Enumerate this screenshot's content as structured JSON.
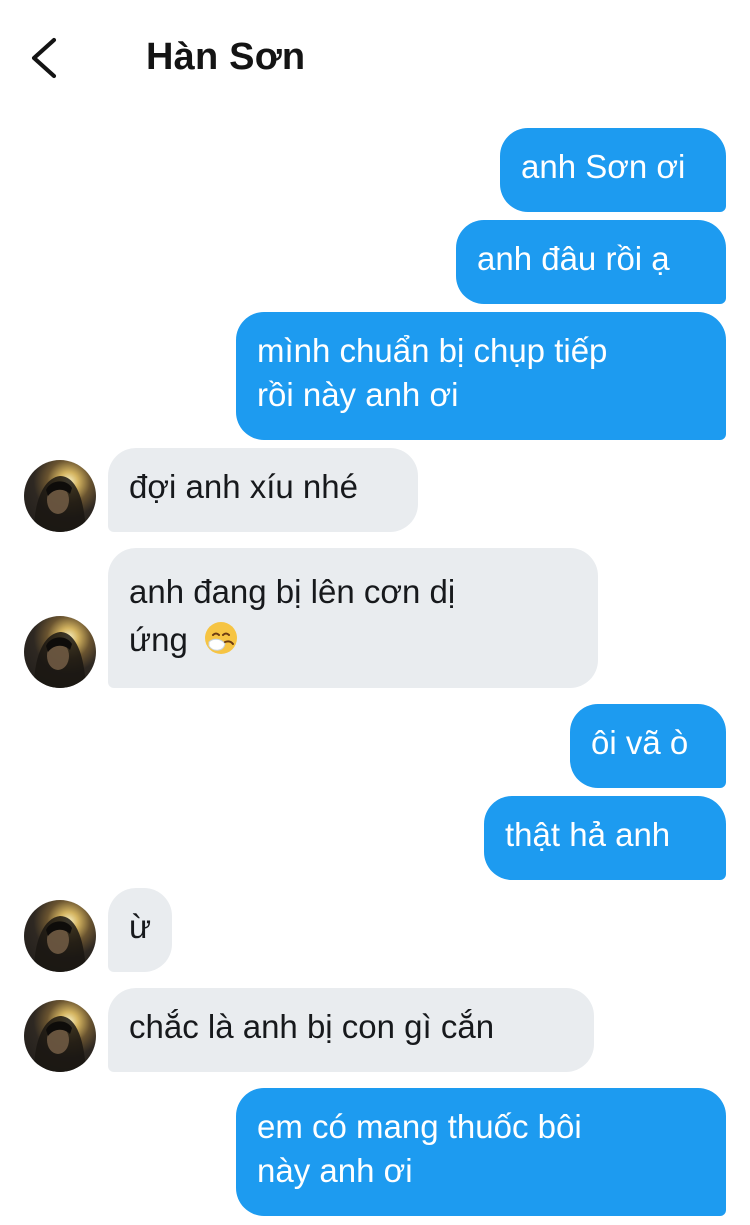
{
  "header": {
    "title": "Hàn Sơn",
    "back_icon": "chevron-left-icon"
  },
  "colors": {
    "outgoing_bubble": "#1d9bf0",
    "incoming_bubble": "#e9ecef",
    "outgoing_text": "#ffffff",
    "incoming_text": "#17191c"
  },
  "messages": [
    {
      "direction": "outgoing",
      "lines": [
        "anh Sơn ơi"
      ]
    },
    {
      "direction": "outgoing",
      "lines": [
        "anh đâu rồi ạ"
      ]
    },
    {
      "direction": "outgoing",
      "lines": [
        "mình chuẩn bị chụp tiếp",
        "rồi này anh ơi"
      ]
    },
    {
      "direction": "incoming",
      "lines": [
        "đợi anh xíu nhé"
      ]
    },
    {
      "direction": "incoming",
      "lines": [
        "anh đang bị lên cơn dị",
        "ứng"
      ],
      "emoji": "sneezing-face-icon"
    },
    {
      "direction": "outgoing",
      "lines": [
        "ôi vã ò"
      ]
    },
    {
      "direction": "outgoing",
      "lines": [
        "thật hả anh"
      ]
    },
    {
      "direction": "incoming",
      "lines": [
        "ừ"
      ]
    },
    {
      "direction": "incoming",
      "lines": [
        "chắc là anh bị con gì cắn"
      ]
    },
    {
      "direction": "outgoing",
      "lines": [
        "em có mang thuốc bôi",
        "này anh ơi"
      ]
    }
  ]
}
